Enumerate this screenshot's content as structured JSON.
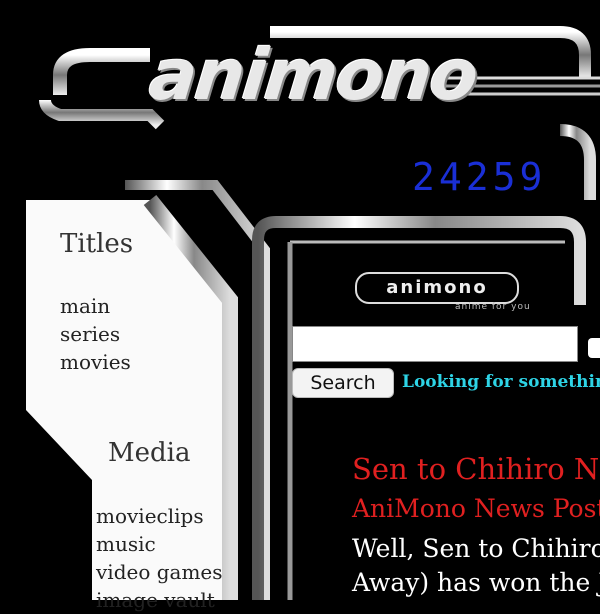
{
  "site": {
    "logo_text": "animono",
    "counter": "24259"
  },
  "sidebar": {
    "titles_heading": "Titles",
    "titles_links": [
      "main",
      "series",
      "movies"
    ],
    "media_heading": "Media",
    "media_links": [
      "movieclips",
      "music",
      "video games",
      "image vault"
    ]
  },
  "main": {
    "inner_logo": "animono",
    "inner_tagline": "anime for you",
    "search": {
      "input_value": "",
      "button_label": "Search",
      "hint": "Looking for something"
    },
    "news": {
      "title": "Sen to Chihiro No",
      "subtitle": "AniMono News Post",
      "body_line1": "Well, Sen to Chihiro",
      "body_line2": "Away) has won the J"
    }
  },
  "colors": {
    "background": "#000000",
    "counter": "#1a2fd6",
    "hint": "#2ed4e6",
    "news_red": "#e02020"
  }
}
